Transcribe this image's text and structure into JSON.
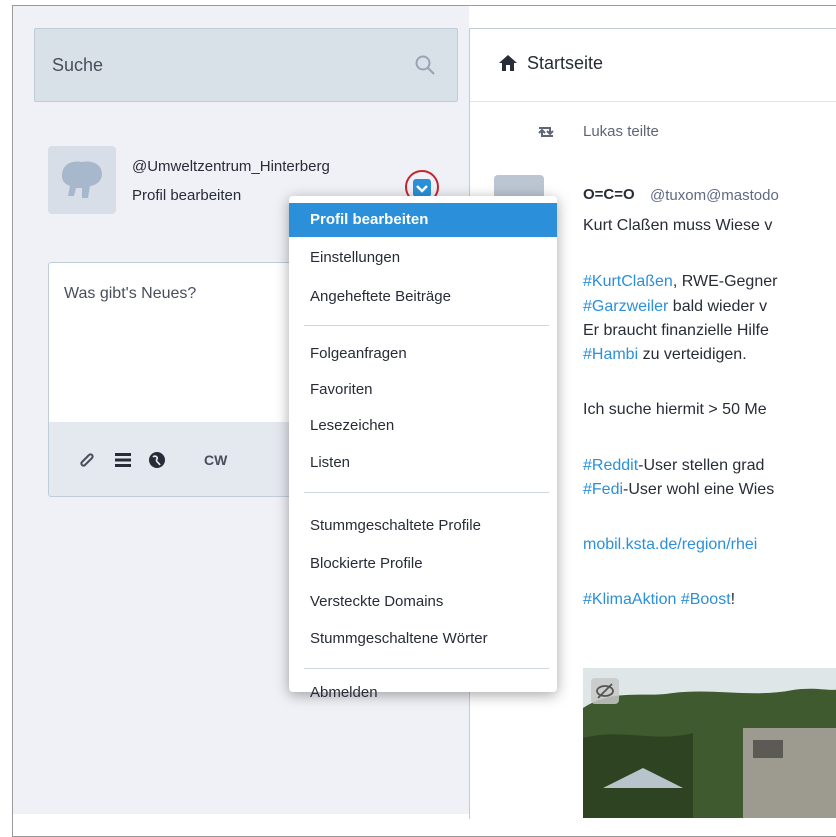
{
  "search": {
    "placeholder": "Suche"
  },
  "profile": {
    "username": "@Umweltzentrum_Hinterberg",
    "edit_label": "Profil bearbeiten"
  },
  "compose": {
    "placeholder": "Was gibt's Neues?",
    "cw_label": "CW",
    "icons": [
      "paperclip-icon",
      "poll-icon",
      "globe-icon"
    ]
  },
  "column": {
    "title": "Startseite",
    "icon": "home-icon"
  },
  "post": {
    "boost_by": "Lukas teilte",
    "display_name": "O=C=O",
    "handle": "@tuxom@mastodo",
    "line1": "Kurt Claßen muss Wiese v",
    "line2_tag": "#KurtClaßen",
    "line2_rest": ", RWE-Gegner",
    "line3_tag": "#Garzweiler",
    "line3_rest": " bald wieder v",
    "line4": "Er braucht finanzielle Hilfe",
    "line5_tag": "#Hambi",
    "line5_rest": " zu verteidigen.",
    "line6": "Ich suche hiermit > 50 Me",
    "line7_tag": "#Reddit",
    "line7_rest": "-User stellen grad",
    "line8_tag": "#Fedi",
    "line8_rest": "-User wohl eine Wies",
    "link": "mobil.ksta.de/region/rhei",
    "tag_a": "#KlimaAktion",
    "tag_b": "#Boost",
    "tag_suffix": "!"
  },
  "menu": {
    "items": [
      "Profil bearbeiten",
      "Einstellungen",
      "Angeheftete Beiträge",
      "Folgeanfragen",
      "Favoriten",
      "Lesezeichen",
      "Listen",
      "Stummgeschaltete Profile",
      "Blockierte Profile",
      "Versteckte Domains",
      "Stummgeschaltene Wörter",
      "Abmelden"
    ],
    "active_index": 0
  },
  "colors": {
    "accent": "#2b90d9",
    "highlight_circle": "#c4262e",
    "sidebar_bg": "#eff1f6"
  }
}
